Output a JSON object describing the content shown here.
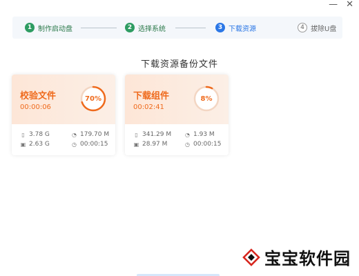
{
  "window_controls": {
    "minimize": "—",
    "close": "✕"
  },
  "steps": [
    {
      "num": "1",
      "label": "制作启动盘",
      "state": "done"
    },
    {
      "num": "2",
      "label": "选择系统",
      "state": "done"
    },
    {
      "num": "3",
      "label": "下载资源",
      "state": "active"
    },
    {
      "num": "4",
      "label": "拔除U盘",
      "state": "todo"
    }
  ],
  "section_title": "下载资源备份文件",
  "cards": [
    {
      "title": "校验文件",
      "elapsed": "00:00:06",
      "percent_label": "70%",
      "progress": 0.7,
      "total_size": "3.78 G",
      "speed": "179.70 M",
      "done_size": "2.63 G",
      "remaining": "00:00:15"
    },
    {
      "title": "下载组件",
      "elapsed": "00:02:41",
      "percent_label": "8%",
      "progress": 0.08,
      "total_size": "341.29 M",
      "speed": "1.93 M",
      "done_size": "28.97 M",
      "remaining": "00:00:15"
    }
  ],
  "icons": {
    "file": "file-icon",
    "speed": "speed-icon",
    "saved": "disk-icon",
    "time": "clock-icon"
  },
  "colors": {
    "accent_orange": "#ef6a1c",
    "step_done": "#2e9c62",
    "step_active": "#2b77e6"
  },
  "watermark": "宝宝软件园"
}
